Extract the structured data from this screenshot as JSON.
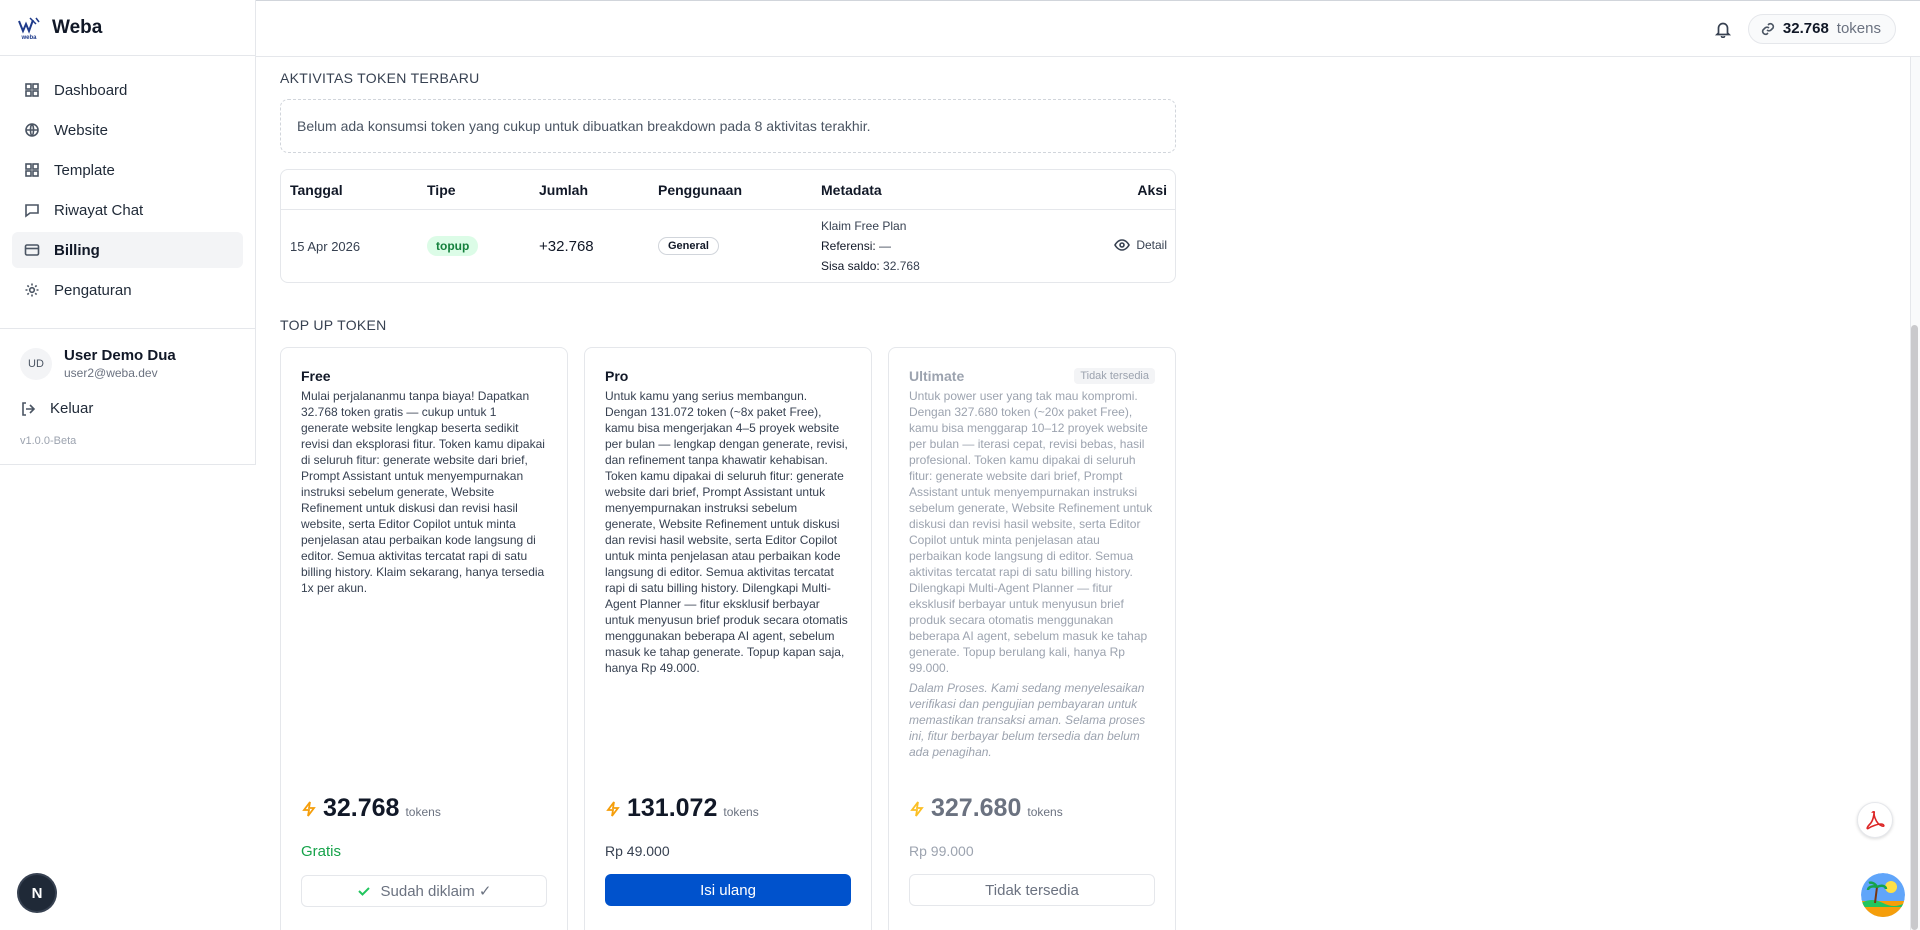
{
  "brand": {
    "name": "Weba"
  },
  "sidebar": {
    "items": [
      {
        "label": "Dashboard",
        "icon": "grid-icon"
      },
      {
        "label": "Website",
        "icon": "globe-icon"
      },
      {
        "label": "Template",
        "icon": "grid-icon"
      },
      {
        "label": "Riwayat Chat",
        "icon": "chat-icon"
      },
      {
        "label": "Billing",
        "icon": "credit-card-icon",
        "active": true
      },
      {
        "label": "Pengaturan",
        "icon": "gear-icon"
      }
    ],
    "user": {
      "initials": "UD",
      "name": "User Demo Dua",
      "email": "user2@weba.dev"
    },
    "logout_label": "Keluar",
    "version": "v1.0.0-Beta"
  },
  "topbar": {
    "token_count": "32.768",
    "token_unit": "tokens"
  },
  "activity": {
    "title": "AKTIVITAS TOKEN TERBARU",
    "empty_message": "Belum ada konsumsi token yang cukup untuk dibuatkan breakdown pada 8 aktivitas terakhir.",
    "columns": [
      "Tanggal",
      "Tipe",
      "Jumlah",
      "Penggunaan",
      "Metadata",
      "Aksi"
    ],
    "rows": [
      {
        "date": "15 Apr 2026",
        "type": "topup",
        "amount": "+32.768",
        "usage": "General",
        "meta_title": "Klaim Free Plan",
        "meta_ref_label": "Referensi:",
        "meta_ref_value": "—",
        "meta_balance_label": "Sisa saldo:",
        "meta_balance_value": "32.768",
        "action": "Detail"
      }
    ]
  },
  "topup": {
    "title": "TOP UP TOKEN",
    "plans": [
      {
        "name": "Free",
        "description": "Mulai perjalananmu tanpa biaya! Dapatkan 32.768 token gratis — cukup untuk 1 generate website lengkap beserta sedikit revisi dan eksplorasi fitur. Token kamu dipakai di seluruh fitur: generate website dari brief, Prompt Assistant untuk menyempurnakan instruksi sebelum generate, Website Refinement untuk diskusi dan revisi hasil website, serta Editor Copilot untuk minta penjelasan atau perbaikan kode langsung di editor. Semua aktivitas tercatat rapi di satu billing history. Klaim sekarang, hanya tersedia 1x per akun.",
        "tokens": "32.768",
        "token_unit": "tokens",
        "price": "Gratis",
        "button": "Sudah diklaim ✓"
      },
      {
        "name": "Pro",
        "description": "Untuk kamu yang serius membangun. Dengan 131.072 token (~8x paket Free), kamu bisa mengerjakan 4–5 proyek website per bulan — lengkap dengan generate, revisi, dan refinement tanpa khawatir kehabisan. Token kamu dipakai di seluruh fitur: generate website dari brief, Prompt Assistant untuk menyempurnakan instruksi sebelum generate, Website Refinement untuk diskusi dan revisi hasil website, serta Editor Copilot untuk minta penjelasan atau perbaikan kode langsung di editor. Semua aktivitas tercatat rapi di satu billing history. Dilengkapi Multi-Agent Planner — fitur eksklusif berbayar untuk menyusun brief produk secara otomatis menggunakan beberapa AI agent, sebelum masuk ke tahap generate. Topup kapan saja, hanya Rp 49.000.",
        "tokens": "131.072",
        "token_unit": "tokens",
        "price": "Rp 49.000",
        "button": "Isi ulang"
      },
      {
        "name": "Ultimate",
        "badge": "Tidak tersedia",
        "description": "Untuk power user yang tak mau kompromi. Dengan 327.680 token (~20x paket Free), kamu bisa menggarap 10–12 proyek website per bulan — iterasi cepat, revisi bebas, hasil profesional. Token kamu dipakai di seluruh fitur: generate website dari brief, Prompt Assistant untuk menyempurnakan instruksi sebelum generate, Website Refinement untuk diskusi dan revisi hasil website, serta Editor Copilot untuk minta penjelasan atau perbaikan kode langsung di editor. Semua aktivitas tercatat rapi di satu billing history. Dilengkapi Multi-Agent Planner — fitur eksklusif berbayar untuk menyusun brief produk secara otomatis menggunakan beberapa AI agent, sebelum masuk ke tahap generate. Topup berulang kali, hanya Rp 99.000.",
        "note": "Dalam Proses. Kami sedang menyelesaikan verifikasi dan pengujian pembayaran untuk memastikan transaksi aman. Selama proses ini, fitur berbayar belum tersedia dan belum ada penagihan.",
        "tokens": "327.680",
        "token_unit": "tokens",
        "price": "Rp 99.000",
        "button": "Tidak tersedia"
      }
    ]
  },
  "floating": {
    "next_label": "N"
  },
  "colors": {
    "primary": "#0052cc",
    "success": "#16a34a",
    "accent": "#f59e0b"
  }
}
